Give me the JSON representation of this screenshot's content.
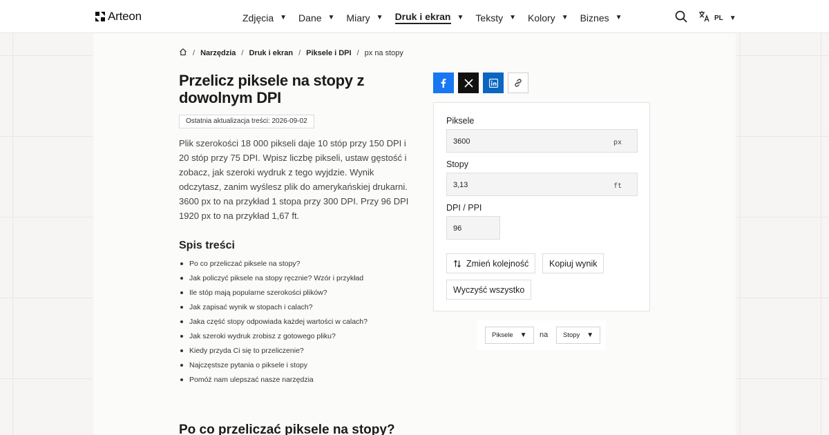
{
  "brand": {
    "name": "Arteon"
  },
  "nav": {
    "items": [
      {
        "label": "Zdjęcia",
        "active": false
      },
      {
        "label": "Dane",
        "active": false
      },
      {
        "label": "Miary",
        "active": false
      },
      {
        "label": "Druk i ekran",
        "active": true
      },
      {
        "label": "Teksty",
        "active": false
      },
      {
        "label": "Kolory",
        "active": false
      },
      {
        "label": "Biznes",
        "active": false
      }
    ],
    "caret": "▼",
    "lang": "PL"
  },
  "breadcrumb": {
    "items": [
      "Narzędzia",
      "Druk i ekran",
      "Piksele i DPI"
    ],
    "current": "px na stopy",
    "separator": "/"
  },
  "article": {
    "title": "Przelicz piksele na stopy z dowolnym DPI",
    "updated": "Ostatnia aktualizacja treści: 2026-09-02",
    "intro": "Plik szerokości 18 000 pikseli daje 10 stóp przy 150 DPI i 20 stóp przy 75 DPI. Wpisz liczbę pikseli, ustaw gęstość i zobacz, jak szeroki wydruk z tego wyjdzie. Wynik odczytasz, zanim wyślesz plik do amerykańskiej drukarni. 3600 px to na przykład 1 stopa przy 300 DPI. Przy 96 DPI 1920 px to na przykład 1,67 ft.",
    "toc_title": "Spis treści",
    "toc": [
      "Po co przeliczać piksele na stopy?",
      "Jak policzyć piksele na stopy ręcznie? Wzór i przykład",
      "Ile stóp mają popularne szerokości plików?",
      "Jak zapisać wynik w stopach i calach?",
      "Jaka część stopy odpowiada każdej wartości w calach?",
      "Jak szeroki wydruk zrobisz z gotowego pliku?",
      "Kiedy przyda Ci się to przeliczenie?",
      "Najczęstsze pytania o piksele i stopy",
      "Pomóż nam ulepszać nasze narzędzia"
    ],
    "section_heading": "Po co przeliczać piksele na stopy?"
  },
  "calculator": {
    "pixels": {
      "label": "Piksele",
      "value": "3600",
      "unit": "px"
    },
    "feet": {
      "label": "Stopy",
      "value": "3,13",
      "unit": "ft"
    },
    "dpi": {
      "label": "DPI / PPI",
      "value": "96"
    },
    "swap_label": "Zmień kolejność",
    "copy_label": "Kopiuj wynik",
    "clear_label": "Wyczyść wszystko"
  },
  "unit_selector": {
    "from": "Piksele",
    "connector": "na",
    "to": "Stopy"
  },
  "colors": {
    "facebook": "#1877f2",
    "x": "#111111",
    "linkedin": "#0a66c2"
  }
}
